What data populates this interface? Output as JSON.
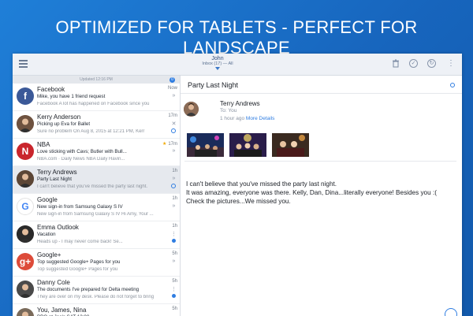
{
  "banner": "OPTIMIZED FOR TABLETS - PERFECT FOR LANDSCAPE",
  "topbar": {
    "account_name": "John",
    "account_folder": "Inbox (17) — All",
    "icons": [
      "menu-icon",
      "trash-icon",
      "check-circle-icon",
      "snooze-icon",
      "more-vert-icon"
    ]
  },
  "list": {
    "updated": "Updated 12:16 PM",
    "badge": "0",
    "rows": [
      {
        "sender": "Facebook",
        "subject": "Mike, you have 1 friend request",
        "preview": "Facebook A lot has happened on Facebook since you",
        "time": "Now",
        "avatar_letter": "f",
        "avatar_color": "#3b5998",
        "action": "»",
        "state": "none"
      },
      {
        "sender": "Kerry Anderson",
        "subject": "Picking up Eva for Ballet",
        "preview": "Sure no problem On Aug 8, 2015 at 12:21 PM, Kerr",
        "time": "17m",
        "avatar_letter": "",
        "avatar_color": "#6e5240",
        "action": "✕",
        "state": "ring"
      },
      {
        "sender": "NBA",
        "subject": "Love sticking with Cavs; Butler with Bull...",
        "preview": "NBA.com · Daily News NBA Daily Havin...",
        "time": "17m",
        "avatar_letter": "N",
        "avatar_color": "#c9252c",
        "action": "»",
        "state": "none",
        "starred": "★"
      },
      {
        "sender": "Terry Andrews",
        "subject": "Party Last Night",
        "preview": "I can't believe that you've missed the party last night.",
        "time": "1h",
        "avatar_letter": "",
        "avatar_color": "#5c4636",
        "action": "»",
        "state": "ring",
        "selected": true
      },
      {
        "sender": "Google",
        "subject": "New sign-in from Samsung Galaxy S IV",
        "preview": "New sign-in from Samsung Galaxy S IV Hi Amy, Your ...",
        "time": "1h",
        "avatar_letter": "G",
        "avatar_color": "#ffffff",
        "action": "»",
        "state": "none"
      },
      {
        "sender": "Emma Outlook",
        "subject": "Vacation",
        "preview": "Heads up - I may never come back! Se...",
        "time": "1h",
        "avatar_letter": "",
        "avatar_color": "#2a2a2a",
        "action": "⋮",
        "state": "dot"
      },
      {
        "sender": "Google+",
        "subject": "Top suggested Google+ Pages for you",
        "preview": "Top suggested Google+ Pages for you",
        "time": "5h",
        "avatar_letter": "g+",
        "avatar_color": "#dd4b39",
        "action": "»",
        "state": "none"
      },
      {
        "sender": "Danny Cole",
        "subject": "The documents I've prepared for Delta meeting",
        "preview": "They are over on my desk. Please do not forget to bring",
        "time": "5h",
        "avatar_letter": "",
        "avatar_color": "#4a4a4a",
        "action": "⋮",
        "state": "dot"
      },
      {
        "sender": "You, James, Nina",
        "subject": "BBQ at Joe's SAT 12:00",
        "preview": "",
        "time": "5h",
        "avatar_letter": "",
        "avatar_color": "#7a6a5a",
        "action": "",
        "state": "ring"
      }
    ]
  },
  "reader": {
    "subject": "Party Last Night",
    "from": "Terry Andrews",
    "to_label": "To:",
    "to_value": "You",
    "time_ago": "1 hour ago",
    "details_link": "More Details",
    "body": [
      "I can't believe that you've missed the party last night.",
      "It was amazing, everyone was there. Kelly, Dan, Dina...literally everyone! Besides you :(",
      "Check the pictures...We missed you."
    ]
  },
  "colors": {
    "accent": "#2f7de1",
    "banner_bg": "#1a6fcc"
  }
}
